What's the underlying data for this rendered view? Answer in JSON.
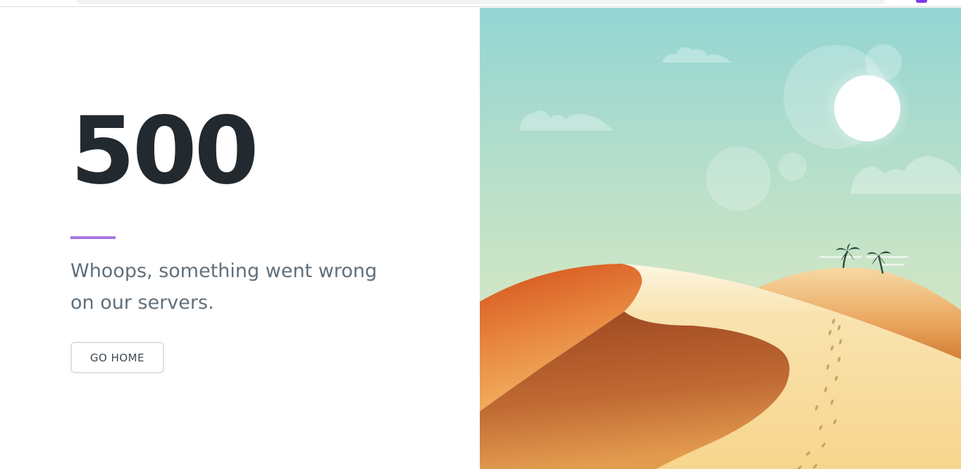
{
  "error": {
    "code": "500",
    "message": "Whoops, something went wrong on our servers."
  },
  "actions": {
    "go_home_label": "GO HOME"
  },
  "colors": {
    "heading": "#22292f",
    "accent": "#a678e2",
    "message_text": "#606f7b",
    "button_border": "#dae1e7",
    "sky_top": "#93d5d3",
    "sky_bottom": "#d4e8c2",
    "dune_orange": "#d4501c",
    "sand_light": "#f7d58c"
  },
  "illustration": {
    "scene": "desert-dunes-illustration",
    "elements": [
      "sun",
      "clouds",
      "sand-dunes",
      "palm-trees",
      "footprints"
    ]
  }
}
